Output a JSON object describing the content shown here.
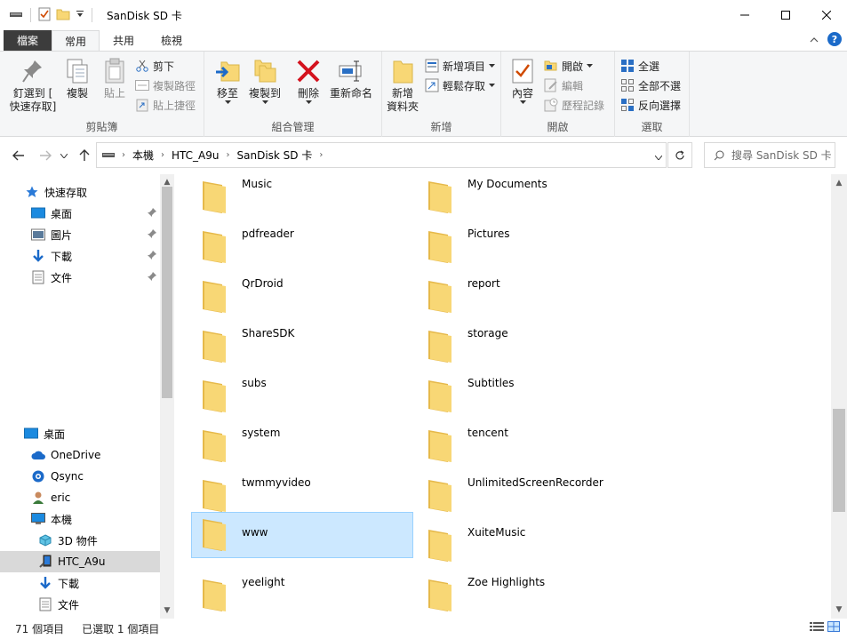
{
  "window": {
    "title": "SanDisk SD 卡",
    "minimize_icon": "minimize-icon",
    "maximize_icon": "maximize-icon",
    "close_icon": "close-icon"
  },
  "ribbon_tabs": {
    "file": "檔案",
    "home": "常用",
    "share": "共用",
    "view": "檢視"
  },
  "ribbon": {
    "clipboard": {
      "label": "剪貼簿",
      "pin": "釘選到 [\n快速存取]",
      "copy": "複製",
      "paste": "貼上",
      "cut": "剪下",
      "copy_path": "複製路徑",
      "paste_shortcut": "貼上捷徑"
    },
    "organize": {
      "label": "組合管理",
      "move_to": "移至",
      "copy_to": "複製到",
      "delete": "刪除",
      "rename": "重新命名"
    },
    "new": {
      "label": "新增",
      "new_folder": "新增\n資料夾",
      "new_item": "新增項目",
      "easy_access": "輕鬆存取"
    },
    "open": {
      "label": "開啟",
      "properties": "內容",
      "open": "開啟",
      "edit": "編輯",
      "history": "歷程記錄"
    },
    "select": {
      "label": "選取",
      "select_all": "全選",
      "select_none": "全部不選",
      "invert": "反向選擇"
    }
  },
  "address": {
    "crumbs": [
      "本機",
      "HTC_A9u",
      "SanDisk SD 卡"
    ],
    "search_placeholder": "搜尋 SanDisk SD 卡"
  },
  "nav_pane": {
    "quick_access": "快速存取",
    "pinned": [
      "桌面",
      "圖片",
      "下載",
      "文件"
    ],
    "desktop": "桌面",
    "onedrive": "OneDrive",
    "qsync": "Qsync",
    "user": "eric",
    "this_pc": "本機",
    "objects3d": "3D 物件",
    "device": "HTC_A9u",
    "downloads": "下載",
    "documents": "文件"
  },
  "folders": {
    "left": [
      "Music",
      "pdfreader",
      "QrDroid",
      "ShareSDK",
      "subs",
      "system",
      "twmmyvideo",
      "www",
      "yeelight"
    ],
    "right": [
      "My Documents",
      "Pictures",
      "report",
      "storage",
      "Subtitles",
      "tencent",
      "UnlimitedScreenRecorder",
      "XuiteMusic",
      "Zoe Highlights"
    ]
  },
  "status": {
    "count": "71 個項目",
    "selected": "已選取 1 個項目"
  },
  "colors": {
    "folder": "#f8d775",
    "selection": "#cce8ff",
    "accent": "#0078d7"
  }
}
